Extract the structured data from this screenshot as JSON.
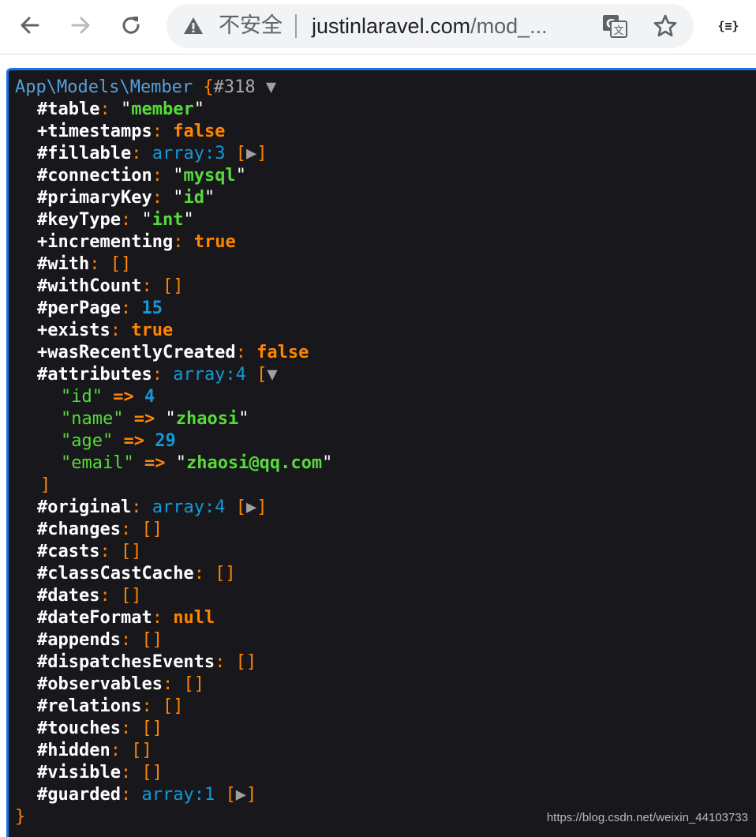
{
  "browser": {
    "security_label": "不安全",
    "url_host": "justinlaravel.com",
    "url_path": "/mod_...",
    "extension_label": "{≡}"
  },
  "dump": {
    "class_name": "App\\Models\\Member",
    "object_id": "#318",
    "properties": [
      {
        "vis": "#",
        "name": "table",
        "type": "string",
        "value": "member"
      },
      {
        "vis": "+",
        "name": "timestamps",
        "type": "keyword",
        "value": "false"
      },
      {
        "vis": "#",
        "name": "fillable",
        "type": "array",
        "value": "array:3",
        "collapsed": true
      },
      {
        "vis": "#",
        "name": "connection",
        "type": "string",
        "value": "mysql"
      },
      {
        "vis": "#",
        "name": "primaryKey",
        "type": "string",
        "value": "id"
      },
      {
        "vis": "#",
        "name": "keyType",
        "type": "string",
        "value": "int"
      },
      {
        "vis": "+",
        "name": "incrementing",
        "type": "keyword",
        "value": "true"
      },
      {
        "vis": "#",
        "name": "with",
        "type": "empty",
        "value": "[]"
      },
      {
        "vis": "#",
        "name": "withCount",
        "type": "empty",
        "value": "[]"
      },
      {
        "vis": "#",
        "name": "perPage",
        "type": "number",
        "value": "15"
      },
      {
        "vis": "+",
        "name": "exists",
        "type": "keyword",
        "value": "true"
      },
      {
        "vis": "+",
        "name": "wasRecentlyCreated",
        "type": "keyword",
        "value": "false"
      },
      {
        "vis": "#",
        "name": "attributes",
        "type": "array",
        "value": "array:4",
        "collapsed": false,
        "items": [
          {
            "key": "id",
            "type": "number",
            "value": "4"
          },
          {
            "key": "name",
            "type": "string",
            "value": "zhaosi"
          },
          {
            "key": "age",
            "type": "number",
            "value": "29"
          },
          {
            "key": "email",
            "type": "string",
            "value": "zhaosi@qq.com"
          }
        ]
      },
      {
        "vis": "#",
        "name": "original",
        "type": "array",
        "value": "array:4",
        "collapsed": true
      },
      {
        "vis": "#",
        "name": "changes",
        "type": "empty",
        "value": "[]"
      },
      {
        "vis": "#",
        "name": "casts",
        "type": "empty",
        "value": "[]"
      },
      {
        "vis": "#",
        "name": "classCastCache",
        "type": "empty",
        "value": "[]"
      },
      {
        "vis": "#",
        "name": "dates",
        "type": "empty",
        "value": "[]"
      },
      {
        "vis": "#",
        "name": "dateFormat",
        "type": "keyword",
        "value": "null"
      },
      {
        "vis": "#",
        "name": "appends",
        "type": "empty",
        "value": "[]"
      },
      {
        "vis": "#",
        "name": "dispatchesEvents",
        "type": "empty",
        "value": "[]"
      },
      {
        "vis": "#",
        "name": "observables",
        "type": "empty",
        "value": "[]"
      },
      {
        "vis": "#",
        "name": "relations",
        "type": "empty",
        "value": "[]"
      },
      {
        "vis": "#",
        "name": "touches",
        "type": "empty",
        "value": "[]"
      },
      {
        "vis": "#",
        "name": "hidden",
        "type": "empty",
        "value": "[]"
      },
      {
        "vis": "#",
        "name": "visible",
        "type": "empty",
        "value": "[]"
      },
      {
        "vis": "#",
        "name": "guarded",
        "type": "array",
        "value": "array:1",
        "collapsed": true
      }
    ]
  },
  "watermark": "https://blog.csdn.net/weixin_44103733"
}
